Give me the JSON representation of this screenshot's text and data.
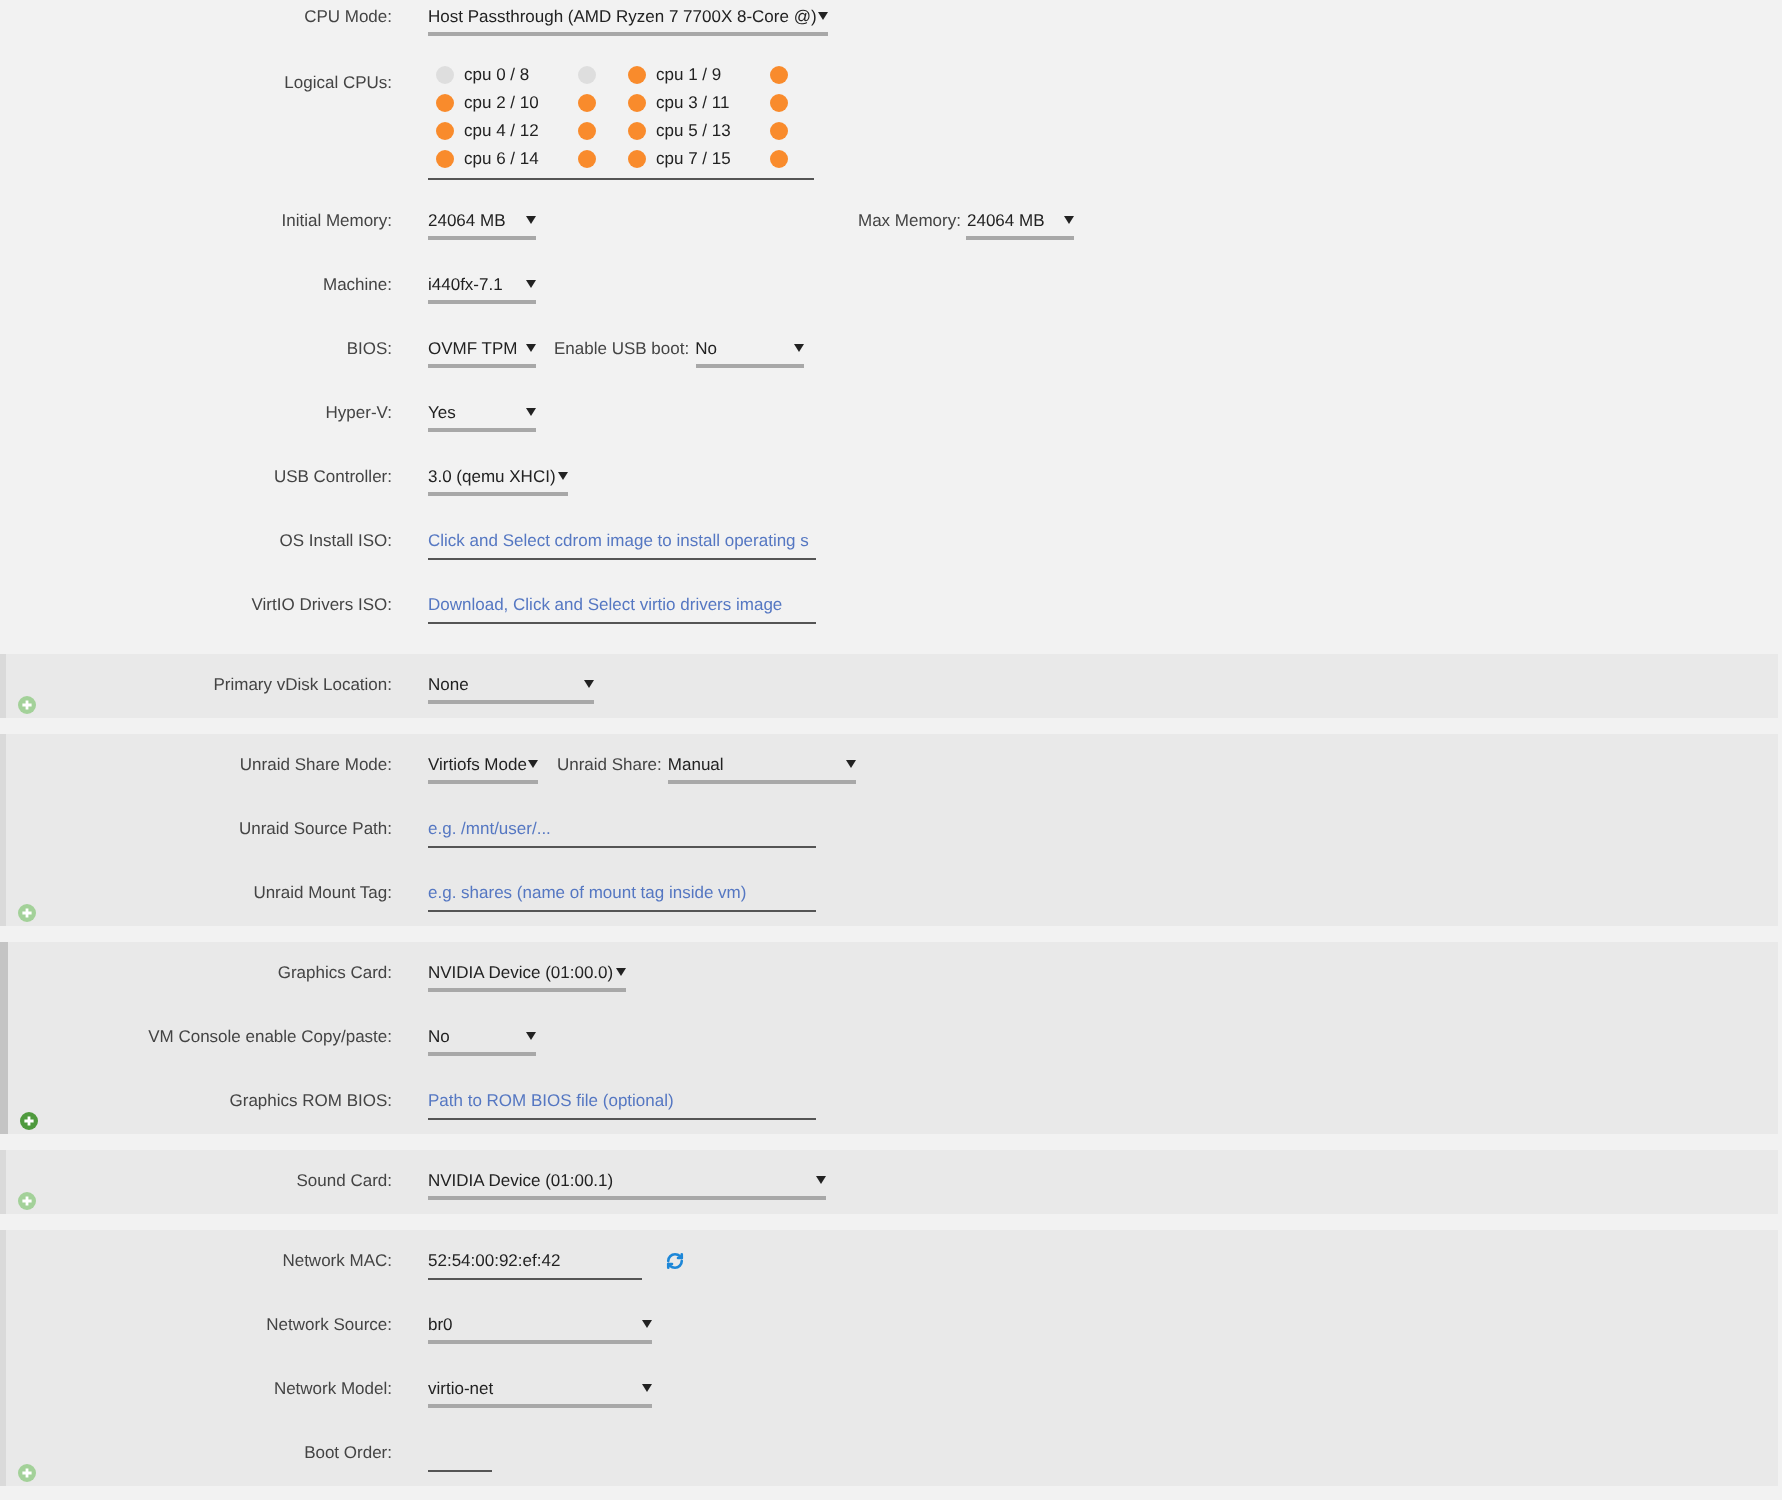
{
  "general": {
    "rows": [
      {
        "label": "CPU Mode:",
        "controls": [
          {
            "kind": "select",
            "value": "Host Passthrough (AMD Ryzen 7 7700X 8-Core @)"
          }
        ]
      },
      {
        "label": "Logical CPUs:",
        "controls": [
          {
            "kind": "cpu_grid",
            "cpus": [
              {
                "label": "cpu 0 / 8",
                "first_checked": false,
                "second_checked": false
              },
              {
                "label": "cpu 1 / 9",
                "first_checked": true,
                "second_checked": true
              },
              {
                "label": "cpu 2 / 10",
                "first_checked": true,
                "second_checked": true
              },
              {
                "label": "cpu 3 / 11",
                "first_checked": true,
                "second_checked": true
              },
              {
                "label": "cpu 4 / 12",
                "first_checked": true,
                "second_checked": true
              },
              {
                "label": "cpu 5 / 13",
                "first_checked": true,
                "second_checked": true
              },
              {
                "label": "cpu 6 / 14",
                "first_checked": true,
                "second_checked": true
              },
              {
                "label": "cpu 7 / 15",
                "first_checked": true,
                "second_checked": true
              }
            ]
          }
        ]
      },
      {
        "label": "Initial Memory:",
        "controls": [
          {
            "kind": "select",
            "value": "24064 MB"
          },
          {
            "kind": "select",
            "label": "Max Memory:",
            "value": "24064 MB"
          }
        ]
      },
      {
        "label": "Machine:",
        "controls": [
          {
            "kind": "select",
            "value": "i440fx-7.1"
          }
        ]
      },
      {
        "label": "BIOS:",
        "controls": [
          {
            "kind": "select",
            "value": "OVMF TPM"
          },
          {
            "kind": "select",
            "label": "Enable USB boot:",
            "value": "No"
          }
        ]
      },
      {
        "label": "Hyper-V:",
        "controls": [
          {
            "kind": "select",
            "value": "Yes"
          }
        ]
      },
      {
        "label": "USB Controller:",
        "controls": [
          {
            "kind": "select",
            "value": "3.0 (qemu XHCI)"
          }
        ]
      },
      {
        "label": "OS Install ISO:",
        "controls": [
          {
            "kind": "input",
            "placeholder": "Click and Select cdrom image to install operating s"
          }
        ]
      },
      {
        "label": "VirtIO Drivers ISO:",
        "controls": [
          {
            "kind": "input",
            "placeholder": "Download, Click and Select virtio drivers image"
          }
        ]
      }
    ]
  },
  "sections": [
    {
      "highlighted": false,
      "rows": [
        {
          "label": "Primary vDisk Location:",
          "controls": [
            {
              "kind": "select",
              "value": "None"
            }
          ]
        }
      ]
    },
    {
      "highlighted": false,
      "rows": [
        {
          "label": "Unraid Share Mode:",
          "controls": [
            {
              "kind": "select",
              "value": "Virtiofs Mode"
            },
            {
              "kind": "select",
              "label": "Unraid Share:",
              "value": "Manual"
            }
          ]
        },
        {
          "label": "Unraid Source Path:",
          "controls": [
            {
              "kind": "input",
              "placeholder": "e.g. /mnt/user/..."
            }
          ]
        },
        {
          "label": "Unraid Mount Tag:",
          "controls": [
            {
              "kind": "input",
              "placeholder": "e.g. shares (name of mount tag inside vm)"
            }
          ]
        }
      ]
    },
    {
      "highlighted": true,
      "rows": [
        {
          "label": "Graphics Card:",
          "controls": [
            {
              "kind": "select",
              "value": "NVIDIA Device (01:00.0)"
            }
          ]
        },
        {
          "label": "VM Console enable Copy/paste:",
          "controls": [
            {
              "kind": "select",
              "value": "No"
            }
          ]
        },
        {
          "label": "Graphics ROM BIOS:",
          "controls": [
            {
              "kind": "input",
              "placeholder": "Path to ROM BIOS file (optional)"
            }
          ]
        }
      ]
    },
    {
      "highlighted": false,
      "rows": [
        {
          "label": "Sound Card:",
          "controls": [
            {
              "kind": "select",
              "value": "NVIDIA Device (01:00.1)"
            }
          ]
        }
      ]
    },
    {
      "highlighted": false,
      "rows": [
        {
          "label": "Network MAC:",
          "controls": [
            {
              "kind": "input",
              "value": "52:54:00:92:ef:42"
            },
            {
              "kind": "refresh"
            }
          ]
        },
        {
          "label": "Network Source:",
          "controls": [
            {
              "kind": "select",
              "value": "br0"
            }
          ]
        },
        {
          "label": "Network Model:",
          "controls": [
            {
              "kind": "select",
              "value": "virtio-net"
            }
          ]
        },
        {
          "label": "Boot Order:",
          "controls": [
            {
              "kind": "input"
            }
          ]
        }
      ]
    }
  ]
}
